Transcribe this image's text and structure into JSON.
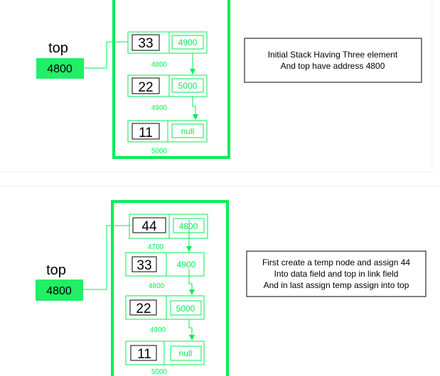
{
  "diagrams": [
    {
      "top_label": "top",
      "top_value": "4800",
      "nodes": [
        {
          "data": "33",
          "link": "4900",
          "address": "4800"
        },
        {
          "data": "22",
          "link": "5000",
          "address": "4900"
        },
        {
          "data": "11",
          "link": "null",
          "address": "5000"
        }
      ],
      "caption": [
        "Initial Stack Having Three element",
        "And top have address 4800"
      ]
    },
    {
      "top_label": "top",
      "top_value": "4800",
      "nodes": [
        {
          "data": "44",
          "link": "4800",
          "address": "4700"
        },
        {
          "data": "33",
          "link": "4900",
          "address": "4800"
        },
        {
          "data": "22",
          "link": "5000",
          "address": "4900"
        },
        {
          "data": "11",
          "link": "null",
          "address": "5000"
        }
      ],
      "caption": [
        "First create a temp node and assign 44",
        "Into data field and top in link field",
        "And in last assign temp assign into top"
      ]
    }
  ],
  "colors": {
    "green": "#00ee55",
    "top_box": "#22ee66",
    "black": "#000000"
  }
}
